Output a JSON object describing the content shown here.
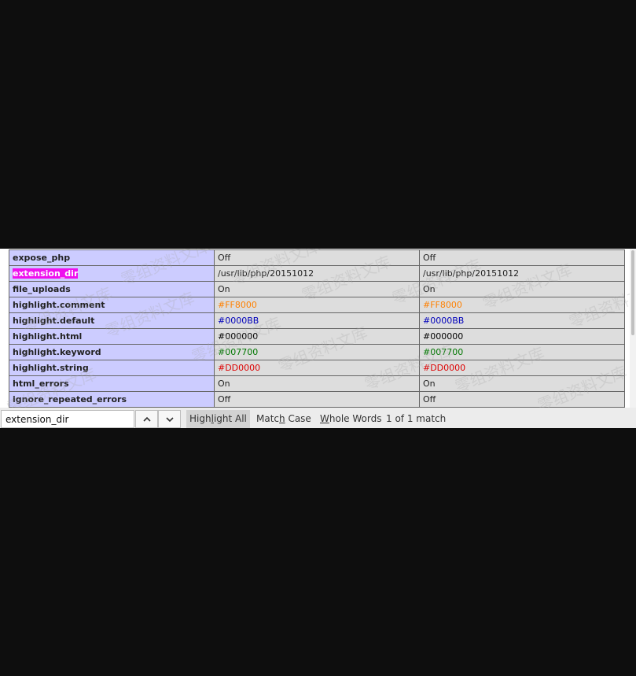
{
  "config_rows": [
    {
      "directive": "expose_php",
      "local": "Off",
      "master": "Off",
      "local_color": "#222222",
      "master_color": "#222222",
      "highlighted": false
    },
    {
      "directive": "extension_dir",
      "local": "/usr/lib/php/20151012",
      "master": "/usr/lib/php/20151012",
      "local_color": "#222222",
      "master_color": "#222222",
      "highlighted": true
    },
    {
      "directive": "file_uploads",
      "local": "On",
      "master": "On",
      "local_color": "#222222",
      "master_color": "#222222",
      "highlighted": false
    },
    {
      "directive": "highlight.comment",
      "local": "#FF8000",
      "master": "#FF8000",
      "local_color": "#FF8000",
      "master_color": "#FF8000",
      "highlighted": false
    },
    {
      "directive": "highlight.default",
      "local": "#0000BB",
      "master": "#0000BB",
      "local_color": "#0000BB",
      "master_color": "#0000BB",
      "highlighted": false
    },
    {
      "directive": "highlight.html",
      "local": "#000000",
      "master": "#000000",
      "local_color": "#000000",
      "master_color": "#000000",
      "highlighted": false
    },
    {
      "directive": "highlight.keyword",
      "local": "#007700",
      "master": "#007700",
      "local_color": "#007700",
      "master_color": "#007700",
      "highlighted": false
    },
    {
      "directive": "highlight.string",
      "local": "#DD0000",
      "master": "#DD0000",
      "local_color": "#DD0000",
      "master_color": "#DD0000",
      "highlighted": false
    },
    {
      "directive": "html_errors",
      "local": "On",
      "master": "On",
      "local_color": "#222222",
      "master_color": "#222222",
      "highlighted": false
    },
    {
      "directive": "ignore_repeated_errors",
      "local": "Off",
      "master": "Off",
      "local_color": "#222222",
      "master_color": "#222222",
      "highlighted": false
    }
  ],
  "findbar": {
    "query": "extension_dir",
    "prev_icon": "chevron-up-icon",
    "next_icon": "chevron-down-icon",
    "highlight_all_label": "Highlight All",
    "match_case_label": "Match Case",
    "whole_words_label": "Whole Words",
    "match_status": "1 of 1 match"
  },
  "colors": {
    "directive_bg": "#CCCCFF",
    "value_bg": "#DDDDDD",
    "find_highlight": "#EE11EE"
  },
  "watermark_text": "零组资料文库"
}
